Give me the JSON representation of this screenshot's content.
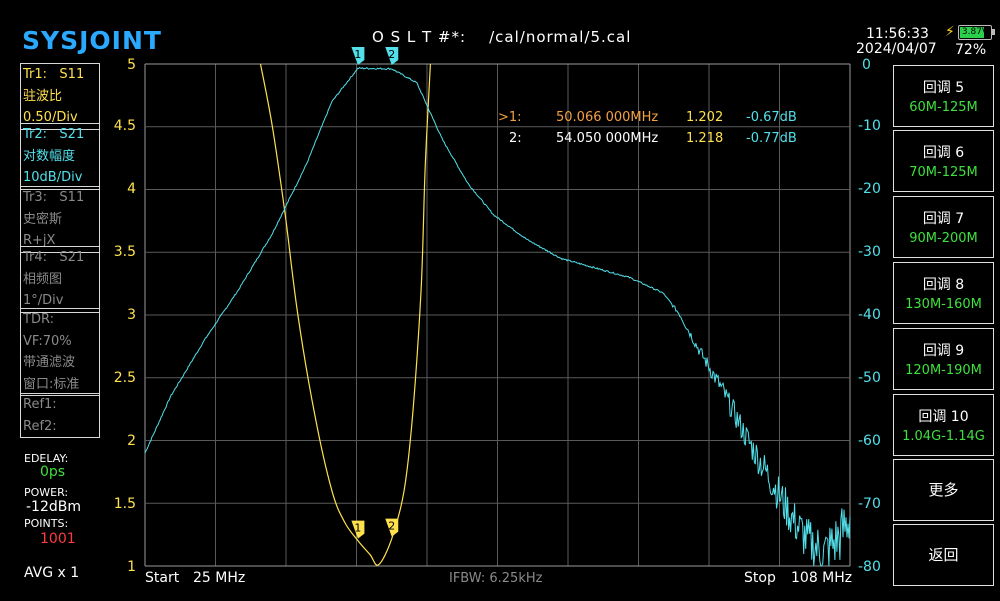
{
  "header": {
    "logo": "SYSJOINT",
    "cal_file": "O S L T #*:    /cal/normal/5.cal",
    "time": "11:56:33",
    "date": "2024/04/07",
    "battery_voltage": "3.87V",
    "battery_percent": "72%"
  },
  "traces": [
    {
      "id": "Tr1:   S11",
      "format": "驻波比",
      "scale": "0.50/Div",
      "color": "#ffe14d"
    },
    {
      "id": "Tr2:   S21",
      "format": "对数幅度",
      "scale": "10dB/Div",
      "color": "#52e0ea"
    },
    {
      "id": "Tr3:   S11",
      "format": "史密斯",
      "scale": "R+jX",
      "color": "#8a8a8a"
    },
    {
      "id": "Tr4:   S21",
      "format": "相频图",
      "scale": "1°/Div",
      "color": "#8a8a8a"
    }
  ],
  "tdr": {
    "title": "TDR:",
    "vf": "VF:70%",
    "mode": "带通滤波",
    "window": "窗口:标准"
  },
  "refs": [
    "Ref1:",
    "Ref2:"
  ],
  "settings": {
    "edelay_label": "EDELAY:",
    "edelay_value": "0ps",
    "power_label": "POWER:",
    "power_value": "-12dBm",
    "points_label": "POINTS:",
    "points_value": "1001",
    "avg": "AVG x 1"
  },
  "markers": [
    {
      "label": ">1:",
      "freq": "50.066 000MHz",
      "swr": "1.202",
      "db": "-0.67dB"
    },
    {
      "label": "2:",
      "freq": "54.050 000MHz",
      "swr": "1.218",
      "db": "-0.77dB"
    }
  ],
  "axes": {
    "left_ticks": [
      "5",
      "4.5",
      "4",
      "3.5",
      "3",
      "2.5",
      "2",
      "1.5",
      "1"
    ],
    "right_ticks": [
      "0",
      "-10",
      "-20",
      "-30",
      "-40",
      "-50",
      "-60",
      "-70",
      "-80"
    ],
    "start_label": "Start",
    "start_value": "25 MHz",
    "ifbw": "IFBW: 6.25kHz",
    "stop_label": "Stop",
    "stop_value": "108 MHz"
  },
  "buttons": [
    {
      "title": "回调 5",
      "sub": "60M-125M"
    },
    {
      "title": "回调 6",
      "sub": "70M-125M"
    },
    {
      "title": "回调 7",
      "sub": "90M-200M"
    },
    {
      "title": "回调 8",
      "sub": "130M-160M"
    },
    {
      "title": "回调 9",
      "sub": "120M-190M"
    },
    {
      "title": "回调 10",
      "sub": "1.04G-1.14G"
    },
    {
      "title": "更多",
      "sub": ""
    },
    {
      "title": "返回",
      "sub": ""
    }
  ],
  "chart_data": {
    "type": "line",
    "x_range_mhz": [
      25,
      108
    ],
    "series": [
      {
        "name": "Tr1:   S11",
        "unit": "SWR",
        "color": "#ffe14d",
        "ylim": [
          1,
          5
        ],
        "x": [
          38.6,
          40.0,
          41.5,
          43.0,
          45.0,
          47.0,
          48.5,
          50.066,
          51.5,
          52.5,
          54.05,
          55.5,
          56.5,
          57.5,
          58.0,
          58.6
        ],
        "values": [
          5.0,
          4.5,
          3.8,
          3.0,
          2.2,
          1.6,
          1.35,
          1.202,
          1.09,
          1.01,
          1.218,
          1.6,
          2.2,
          3.2,
          4.2,
          5.0
        ]
      },
      {
        "name": "Tr2:   S21",
        "unit": "dB",
        "color": "#52e0ea",
        "ylim": [
          -80,
          0
        ],
        "x": [
          25,
          28,
          32,
          36,
          40,
          44,
          47,
          50.066,
          54.05,
          57,
          60,
          63,
          66,
          70,
          74,
          78,
          82,
          86,
          88,
          90,
          93,
          96,
          99,
          101,
          103,
          105,
          107,
          108
        ],
        "values": [
          -62,
          -53,
          -44,
          -36,
          -27,
          -16,
          -6,
          -0.67,
          -0.77,
          -3,
          -12,
          -19,
          -24,
          -28,
          -31,
          -32.5,
          -34,
          -36.5,
          -40,
          -45,
          -52,
          -60,
          -67,
          -72,
          -76,
          -78,
          -75,
          -72
        ]
      }
    ],
    "marker_freqs": [
      50.066,
      54.05
    ]
  }
}
